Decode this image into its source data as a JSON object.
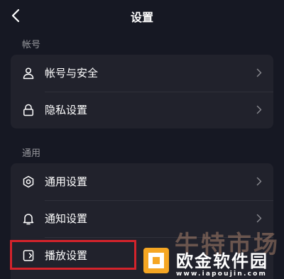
{
  "header": {
    "title": "设置",
    "back_icon": "chevron-left-icon"
  },
  "sections": [
    {
      "title": "帐号",
      "items": [
        {
          "label": "帐号与安全",
          "icon": "user-icon"
        },
        {
          "label": "隐私设置",
          "icon": "lock-icon"
        }
      ]
    },
    {
      "title": "通用",
      "items": [
        {
          "label": "通用设置",
          "icon": "gear-icon"
        },
        {
          "label": "通知设置",
          "icon": "bell-icon"
        },
        {
          "label": "播放设置",
          "icon": "play-settings-icon"
        }
      ]
    }
  ],
  "watermark": {
    "big_text": "牛特市场",
    "title": "欧金软件园",
    "url": "www.iapoujin.com"
  },
  "colors": {
    "background": "#161823",
    "card": "#21222c",
    "highlight": "#d4232b",
    "logo": "#f5a623"
  }
}
